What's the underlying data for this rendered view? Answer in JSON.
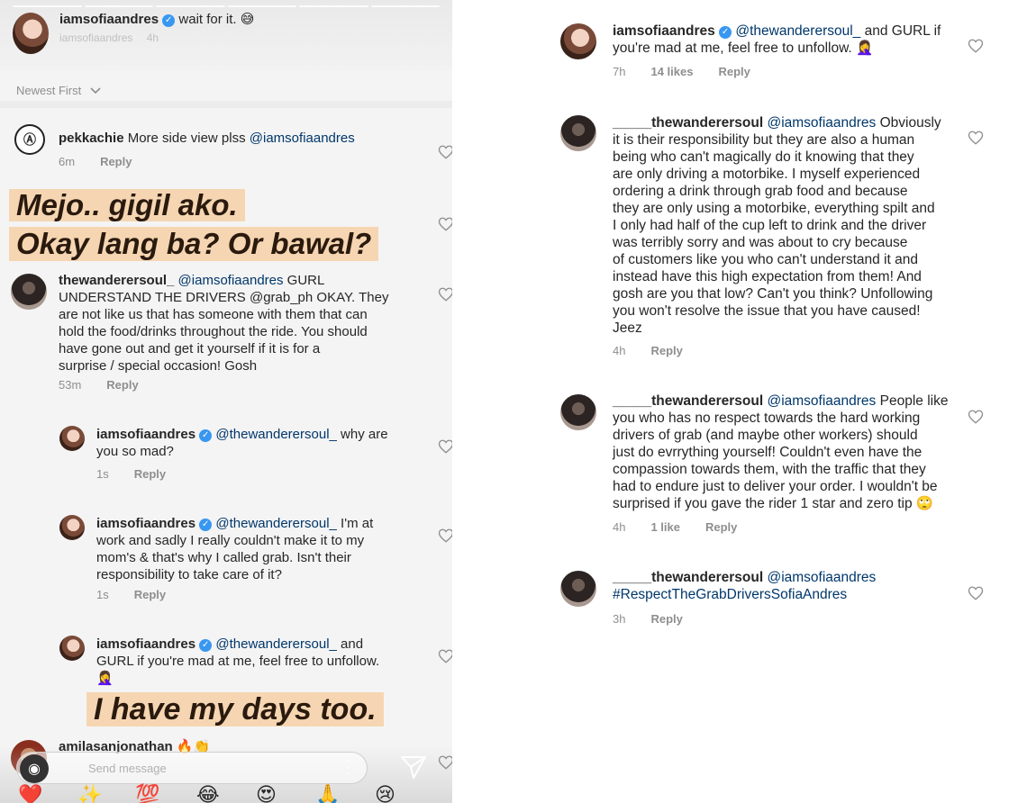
{
  "story": {
    "owner": "iamsofiaandres",
    "caption": "wait for it. 😅",
    "sub_owner": "iamsofiaandres",
    "sub_time": "4h",
    "sort_label": "Newest First"
  },
  "left_comments": [
    {
      "user": "pekkachie",
      "text": "More side view plss",
      "mention": "@iamsofiaandres",
      "time": "6m",
      "reply": "Reply"
    },
    {
      "user": "thewanderersoul_",
      "mention": "@iamsofiaandres",
      "lines": [
        "GURL",
        "UNDERSTAND THE DRIVERS @grab_ph OKAY. They",
        "are not like us that has someone with them that can",
        "hold the food/drinks throughout the ride. You should",
        "have gone out and get it yourself if it is for a",
        "surprise / special occasion! Gosh"
      ],
      "time": "53m",
      "reply": "Reply"
    },
    {
      "user": "iamsofiaandres",
      "mention": "@thewanderersoul_",
      "lines": [
        "why are",
        "you so mad?"
      ],
      "time": "1s",
      "reply": "Reply"
    },
    {
      "user": "iamsofiaandres",
      "mention": "@thewanderersoul_",
      "lines": [
        "I'm at",
        "work and sadly I really couldn't make it to my",
        "mom's & that's why I called grab. Isn't their",
        "responsibility to take care of it?"
      ],
      "time": "1s",
      "reply": "Reply"
    },
    {
      "user": "iamsofiaandres",
      "mention": "@thewanderersoul_",
      "lines": [
        "and",
        "GURL if you're mad at me, feel free to unfollow.",
        "🤦‍♀️"
      ],
      "time": "",
      "reply": ""
    },
    {
      "user": "amilasanjonathan",
      "text": "🔥👏"
    }
  ],
  "banners": {
    "b1": "Mejo.. gigil ako.",
    "b2": "Okay lang ba? Or bawal?",
    "b3": "I have my days too."
  },
  "composer": {
    "placeholder": "Send message",
    "emojis": [
      "❤️",
      "✨",
      "💯",
      "😂",
      "😍",
      "🙏",
      "😢"
    ]
  },
  "right_comments": [
    {
      "user": "iamsofiaandres",
      "mention": "@thewanderersoul_",
      "lines": [
        "and GURL if",
        "you're mad at me, feel free to unfollow. 🤦‍♀️"
      ],
      "time": "7h",
      "likes": "14 likes",
      "reply": "Reply"
    },
    {
      "user": "_____thewanderersoul",
      "mention": "@iamsofiaandres",
      "lines": [
        "Obviously",
        "it is their responsibility but they are also a human",
        "being who can't magically do it knowing that they",
        "are only driving a motorbike. I myself experienced",
        "ordering a drink through grab food and because",
        "they are only using a motorbike, everything spilt and",
        "I only had half of the cup left to drink and the driver",
        "was terribly sorry and was about to cry because",
        "of customers like you who can't understand it and",
        "instead have this high expectation from them! And",
        "gosh are you that low? Can't you think? Unfollowing",
        "you won't resolve the issue that you have caused!",
        "Jeez"
      ],
      "time": "4h",
      "likes": "",
      "reply": "Reply"
    },
    {
      "user": "_____thewanderersoul",
      "mention": "@iamsofiaandres",
      "lines": [
        "People like",
        "you who has no respect towards the hard working",
        "drivers of grab (and maybe other workers) should",
        "just do evrrything yourself! Couldn't even have the",
        "compassion towards them, with the traffic that they",
        "had to endure just to deliver your order. I wouldn't be",
        "surprised if you gave the rider 1 star and zero tip 🙄"
      ],
      "time": "4h",
      "likes": "1 like",
      "reply": "Reply"
    },
    {
      "user": "_____thewanderersoul",
      "mention": "@iamsofiaandres",
      "lines": [
        "#RespectTheGrabDriversSofiaAndres"
      ],
      "time": "3h",
      "likes": "",
      "reply": "Reply"
    }
  ]
}
